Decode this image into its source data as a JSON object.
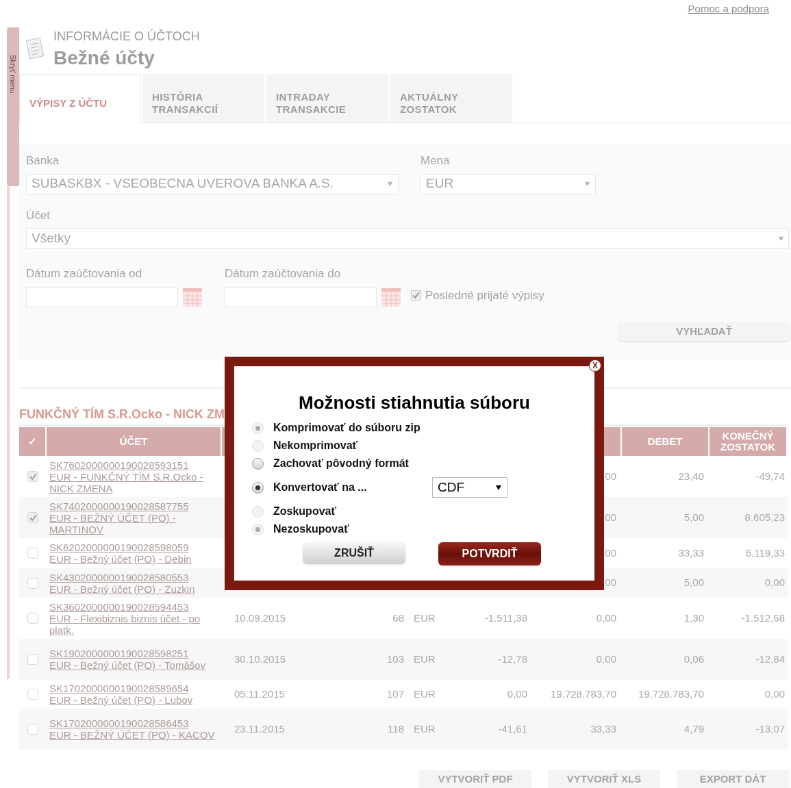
{
  "header": {
    "help_link": "Pomoc a podpora",
    "hide_menu": "Skryť menu",
    "section_label": "INFORMÁCIE O ÚČTOCH",
    "page_title": "Bežné účty"
  },
  "tabs": [
    {
      "label": "VÝPISY Z ÚČTU",
      "selected": true
    },
    {
      "label": "HISTÓRIA TRANSAKCIÍ",
      "selected": false
    },
    {
      "label": "INTRADAY TRANSAKCIE",
      "selected": false
    },
    {
      "label": "AKTUÁLNY ZOSTATOK",
      "selected": false
    }
  ],
  "form": {
    "bank": {
      "label": "Banka",
      "value": "SUBASKBX - VSEOBECNA UVEROVA BANKA A.S."
    },
    "currency": {
      "label": "Mena",
      "value": "EUR"
    },
    "account": {
      "label": "Účet",
      "value": "Všetky"
    },
    "date_from": {
      "label": "Dátum zaúčtovania od"
    },
    "date_to": {
      "label": "Dátum zaúčtovania do"
    },
    "last_received": {
      "label": "Posledné prijaté výpisy",
      "checked": true
    },
    "search_button": "VYHĽADAŤ"
  },
  "table": {
    "title": "FUNKČNÝ TÍM S.R.Ocko - NICK ZM",
    "columns": {
      "select": "✓",
      "account": "ÚČET",
      "debet": "DEBET",
      "closing": "KONEČNÝ ZOSTATOK"
    },
    "rows": [
      {
        "checked": true,
        "account": "SK7602000000190028593151",
        "name": "EUR - FUNKČNÝ TÍM S.R.Ocko - NICK ZMENA",
        "credit": "00",
        "debet": "23,40",
        "closing": "-49,74"
      },
      {
        "checked": true,
        "account": "SK7402000000190028587755",
        "name": "EUR - BEŽNÝ ÚČET (PO) - MARTINOV",
        "credit": "00",
        "debet": "5,00",
        "closing": "8.605,23"
      },
      {
        "checked": false,
        "account": "SK6202000000190028598059",
        "name": "EUR - Bežný účet (PO) - Debin",
        "credit": "00",
        "debet": "33,33",
        "closing": "6.119,33"
      },
      {
        "checked": false,
        "account": "SK4302000000190028580553",
        "name": "EUR - Bežný účet (PO) - Zuzkin",
        "credit": "00",
        "debet": "5,00",
        "closing": "0,00"
      },
      {
        "checked": false,
        "account": "SK3602000000190028594453",
        "name": "EUR - Flexibiznis biznis účet - po platk.",
        "date": "10.09.2015",
        "number": "68",
        "currency": "EUR",
        "opening": "-1.511,38",
        "credit": "0,00",
        "debet": "1,30",
        "closing": "-1.512,68"
      },
      {
        "checked": false,
        "account": "SK1902000000190028598251",
        "name": "EUR - Bežný účet (PO) - Tomášov",
        "date": "30.10.2015",
        "number": "103",
        "currency": "EUR",
        "opening": "-12,78",
        "credit": "0,00",
        "debet": "0,06",
        "closing": "-12,84"
      },
      {
        "checked": false,
        "account": "SK1702000000190028589654",
        "name": "EUR - Bežný účet (PO) - Lubov",
        "date": "05.11.2015",
        "number": "107",
        "currency": "EUR",
        "opening": "0,00",
        "credit": "19.728.783,70",
        "debet": "19.728.783,70",
        "closing": "0,00"
      },
      {
        "checked": false,
        "account": "SK1702000000190028586453",
        "name": "EUR - BEŽNÝ ÚČET (PO) - KACOV",
        "date": "23.11.2015",
        "number": "118",
        "currency": "EUR",
        "opening": "-41,61",
        "credit": "33,33",
        "debet": "4,79",
        "closing": "-13,07"
      }
    ]
  },
  "footer_buttons": [
    "VYTVORIŤ PDF",
    "VYTVORIŤ XLS",
    "EXPORT DÁT"
  ],
  "dialog": {
    "close": "X",
    "title": "Možnosti stiahnutia súboru",
    "options": [
      {
        "label": "Komprimovať do súboru zip",
        "selected": true,
        "disabled": true
      },
      {
        "label": "Nekomprimovať",
        "selected": false,
        "disabled": true
      },
      {
        "label": "Zachovať pôvodný formát",
        "selected": false,
        "disabled": false
      },
      {
        "label": "Konvertovať na ...",
        "selected": true,
        "disabled": false,
        "format": "CDF"
      },
      {
        "label": "Zoskupovať",
        "selected": false,
        "disabled": true
      },
      {
        "label": "Nezoskupovať",
        "selected": true,
        "disabled": true
      }
    ],
    "cancel": "ZRUŠIŤ",
    "confirm": "POTVRDIŤ"
  }
}
